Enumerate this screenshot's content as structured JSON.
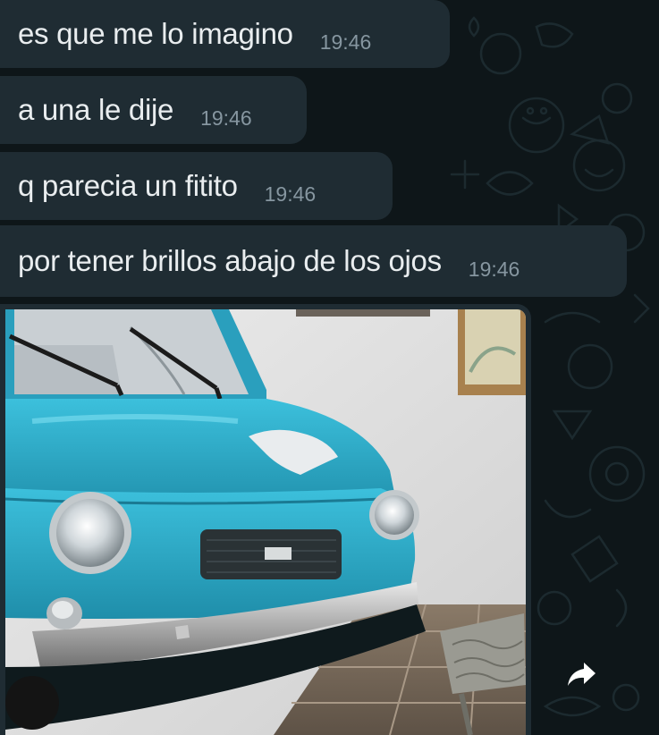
{
  "chat": {
    "messages": [
      {
        "text": "es que me lo imagino",
        "time": "19:46"
      },
      {
        "text": "a una le dije",
        "time": "19:46"
      },
      {
        "text": "q parecia un fitito",
        "time": "19:46"
      },
      {
        "text": "por tener brillos abajo de los ojos",
        "time": "19:46"
      }
    ],
    "image_message": {
      "subject": "photo of a light-blue Fiat 600 car"
    }
  },
  "icons": {
    "forward": "forward-arrow-icon"
  },
  "colors": {
    "chat_background": "#0e1619",
    "bubble_background": "#1f2c33",
    "message_text": "#e9edef",
    "timestamp_text": "#8696a0",
    "car_body": "#2ba9c6"
  }
}
